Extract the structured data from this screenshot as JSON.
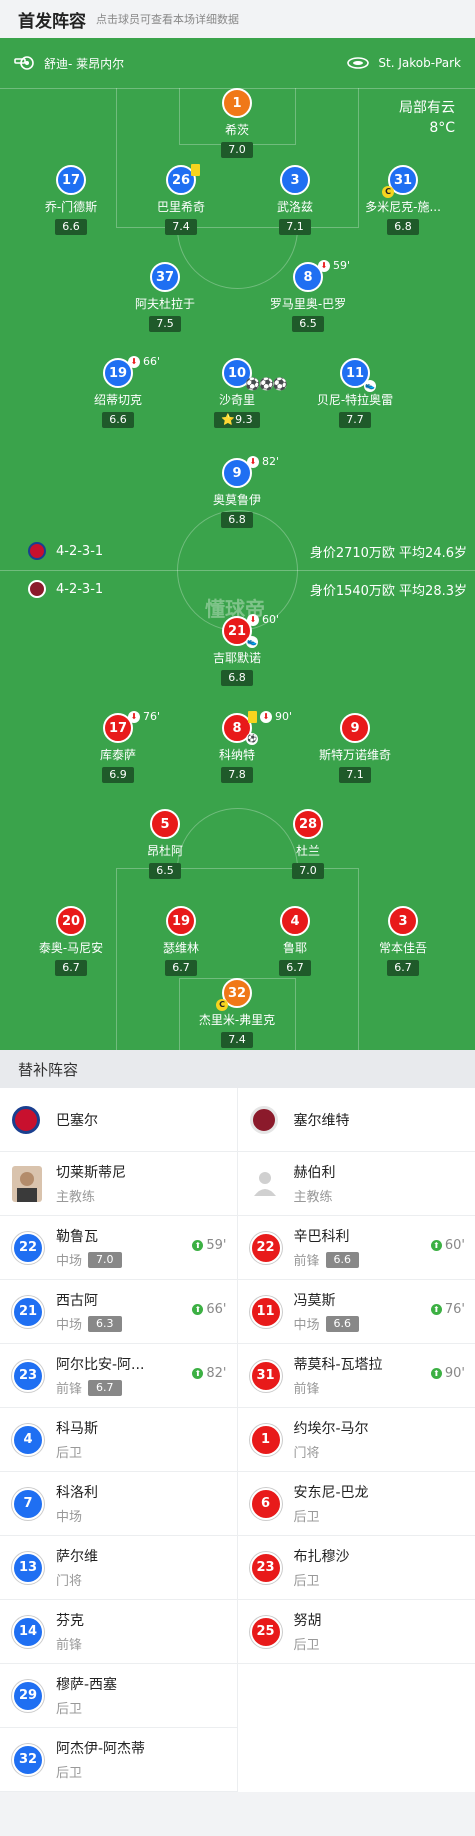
{
  "header": {
    "title": "首发阵容",
    "subtitle": "点击球员可查看本场详细数据"
  },
  "pitch": {
    "referee": "舒迪- 莱昂内尔",
    "stadium": "St. Jakob-Park",
    "weather": "局部有云",
    "temperature": "8°C",
    "watermark": "懂球帝",
    "home_formation": "4-2-3-1",
    "home_value": "身价2710万欧 平均24.6岁",
    "away_formation": "4-2-3-1",
    "away_value": "身价1540万欧 平均28.3岁"
  },
  "home_players": [
    {
      "num": "1",
      "name": "希茨",
      "rating": "7.0"
    },
    {
      "num": "17",
      "name": "乔-门德斯",
      "rating": "6.6"
    },
    {
      "num": "26",
      "name": "巴里希奇",
      "rating": "7.4"
    },
    {
      "num": "3",
      "name": "武洛兹",
      "rating": "7.1"
    },
    {
      "num": "31",
      "name": "多米尼克-施...",
      "rating": "6.8"
    },
    {
      "num": "37",
      "name": "阿夫杜拉于",
      "rating": "7.5"
    },
    {
      "num": "8",
      "name": "罗马里奥-巴罗",
      "rating": "6.5",
      "sub_time": "59'"
    },
    {
      "num": "19",
      "name": "绍蒂切克",
      "rating": "6.6",
      "sub_time": "66'"
    },
    {
      "num": "10",
      "name": "沙奇里",
      "rating": "9.3",
      "goals": "⚽⚽⚽"
    },
    {
      "num": "11",
      "name": "贝尼-特拉奥雷",
      "rating": "7.7"
    },
    {
      "num": "9",
      "name": "奥莫鲁伊",
      "rating": "6.8",
      "sub_time": "82'"
    }
  ],
  "away_players": [
    {
      "num": "21",
      "name": "吉耶默诺",
      "rating": "6.8",
      "sub_time": "60'"
    },
    {
      "num": "17",
      "name": "库泰萨",
      "rating": "6.9",
      "sub_time": "76'"
    },
    {
      "num": "8",
      "name": "科纳特",
      "rating": "7.8",
      "sub_time": "90'"
    },
    {
      "num": "9",
      "name": "斯特万诺维奇",
      "rating": "7.1"
    },
    {
      "num": "5",
      "name": "昂杜阿",
      "rating": "6.5"
    },
    {
      "num": "28",
      "name": "杜兰",
      "rating": "7.0"
    },
    {
      "num": "20",
      "name": "泰奥-马尼安",
      "rating": "6.7"
    },
    {
      "num": "19",
      "name": "瑟维林",
      "rating": "6.7"
    },
    {
      "num": "4",
      "name": "鲁耶",
      "rating": "6.7"
    },
    {
      "num": "3",
      "name": "常本佳吾",
      "rating": "6.7"
    },
    {
      "num": "32",
      "name": "杰里米-弗里克",
      "rating": "7.4"
    }
  ],
  "subs": {
    "title": "替补阵容",
    "home_team": "巴塞尔",
    "away_team": "塞尔维特",
    "home_coach": {
      "name": "切莱斯蒂尼",
      "role": "主教练"
    },
    "away_coach": {
      "name": "赫伯利",
      "role": "主教练"
    },
    "home": [
      {
        "num": "22",
        "name": "勒鲁瓦",
        "pos": "中场",
        "rating": "7.0",
        "time": "59'"
      },
      {
        "num": "21",
        "name": "西古阿",
        "pos": "中场",
        "rating": "6.3",
        "time": "66'"
      },
      {
        "num": "23",
        "name": "阿尔比安-阿...",
        "pos": "前锋",
        "rating": "6.7",
        "time": "82'"
      },
      {
        "num": "4",
        "name": "科马斯",
        "pos": "后卫"
      },
      {
        "num": "7",
        "name": "科洛利",
        "pos": "中场"
      },
      {
        "num": "13",
        "name": "萨尔维",
        "pos": "门将"
      },
      {
        "num": "14",
        "name": "芬克",
        "pos": "前锋"
      },
      {
        "num": "29",
        "name": "穆萨-西塞",
        "pos": "后卫"
      },
      {
        "num": "32",
        "name": "阿杰伊-阿杰蒂",
        "pos": "后卫"
      }
    ],
    "away": [
      {
        "num": "22",
        "name": "辛巴科利",
        "pos": "前锋",
        "rating": "6.6",
        "time": "60'"
      },
      {
        "num": "11",
        "name": "冯莫斯",
        "pos": "中场",
        "rating": "6.6",
        "time": "76'"
      },
      {
        "num": "31",
        "name": "蒂莫科-瓦塔拉",
        "pos": "前锋",
        "time": "90'"
      },
      {
        "num": "1",
        "name": "约埃尔-马尔",
        "pos": "门将"
      },
      {
        "num": "6",
        "name": "安东尼-巴龙",
        "pos": "后卫"
      },
      {
        "num": "23",
        "name": "布扎穆沙",
        "pos": "后卫"
      },
      {
        "num": "25",
        "name": "努胡",
        "pos": "后卫"
      }
    ]
  }
}
